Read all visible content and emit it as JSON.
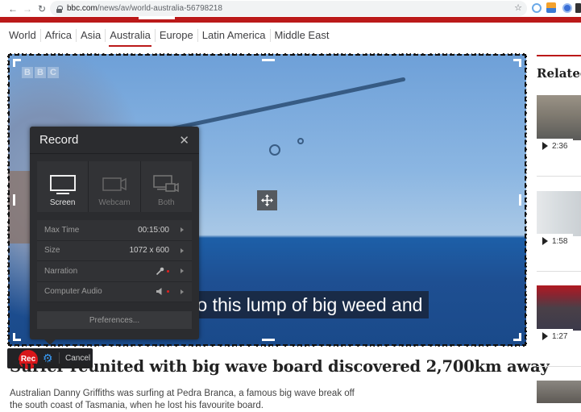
{
  "browser": {
    "url_host": "bbc.com",
    "url_path": "/news/av/world-australia-56798218",
    "extensions": [
      "circle-extension-icon",
      "rss-feed-icon",
      "shield-extension-icon",
      "extension-icon"
    ]
  },
  "nav": {
    "sections": [
      {
        "label": "World",
        "active": false
      },
      {
        "label": "Africa",
        "active": false
      },
      {
        "label": "Asia",
        "active": false
      },
      {
        "label": "Australia",
        "active": true
      },
      {
        "label": "Europe",
        "active": false
      },
      {
        "label": "Latin America",
        "active": false
      },
      {
        "label": "Middle East",
        "active": false
      }
    ]
  },
  "video": {
    "watermark": [
      "B",
      "B",
      "C"
    ],
    "subtitle": "to this lump of big weed and"
  },
  "record_panel": {
    "title": "Record",
    "modes": [
      {
        "label": "Screen",
        "icon": "monitor-icon",
        "active": true
      },
      {
        "label": "Webcam",
        "icon": "webcam-icon",
        "active": false
      },
      {
        "label": "Both",
        "icon": "screen-and-webcam-icon",
        "active": false
      }
    ],
    "settings": [
      {
        "label": "Max Time",
        "value": "00:15:00"
      },
      {
        "label": "Size",
        "value": "1072 x 600"
      },
      {
        "label": "Narration",
        "value": "",
        "icon": "microphone-icon",
        "status": "off"
      },
      {
        "label": "Computer Audio",
        "value": "",
        "icon": "speaker-icon",
        "status": "off"
      }
    ],
    "preferences_label": "Preferences..."
  },
  "toolbar": {
    "rec_label": "Rec",
    "cancel_label": "Cancel"
  },
  "article": {
    "headline": "Surfer reunited with big wave board discovered 2,700km away",
    "summary": "Australian Danny Griffiths was surfing at Pedra Branca, a famous big wave break off the south coast of Tasmania, when he lost his favourite board."
  },
  "related": {
    "title": "Related",
    "items": [
      {
        "duration": "2:36"
      },
      {
        "duration": "1:58"
      },
      {
        "duration": "1:27"
      }
    ]
  },
  "colors": {
    "bbc_red": "#bb1919",
    "rec_red": "#d8161a",
    "gear_blue": "#3aa0ff",
    "panel_bg": "#2b2c2f"
  }
}
